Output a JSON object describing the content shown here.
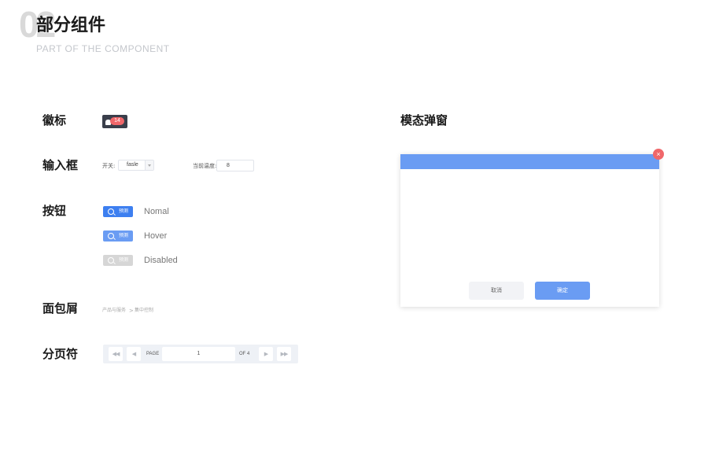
{
  "header": {
    "bg_number": "02",
    "title": "部分组件",
    "subtitle": "PART OF THE COMPONENT"
  },
  "sections": {
    "badge": "徽标",
    "input": "输入框",
    "button": "按钮",
    "breadcrumb": "面包屑",
    "pagination": "分页符",
    "modal": "模态弹窗"
  },
  "badge": {
    "count": "14"
  },
  "inputs": {
    "switch_label": "开关:",
    "switch_value": "fasle",
    "temp_label": "当前温度:",
    "temp_value": "8"
  },
  "buttons": {
    "label": "预测",
    "states": [
      "Nomal",
      "Hover",
      "Disabled"
    ]
  },
  "breadcrumb": {
    "items": [
      "产品与服务",
      "集中控制"
    ],
    "separator": ">"
  },
  "pagination": {
    "first": "◀◀",
    "prev": "◀",
    "page_label": "PAGE",
    "current": "1",
    "of_label": "OF 4",
    "next": "▶",
    "last": "▶▶"
  },
  "modal": {
    "cancel": "取消",
    "ok": "确定",
    "close": "×"
  },
  "colors": {
    "primary": "#3d7ff0",
    "hover": "#6a9cf3",
    "disabled": "#d6d6d6",
    "danger": "#f0676a",
    "badge_bg": "#3a3f4b"
  }
}
